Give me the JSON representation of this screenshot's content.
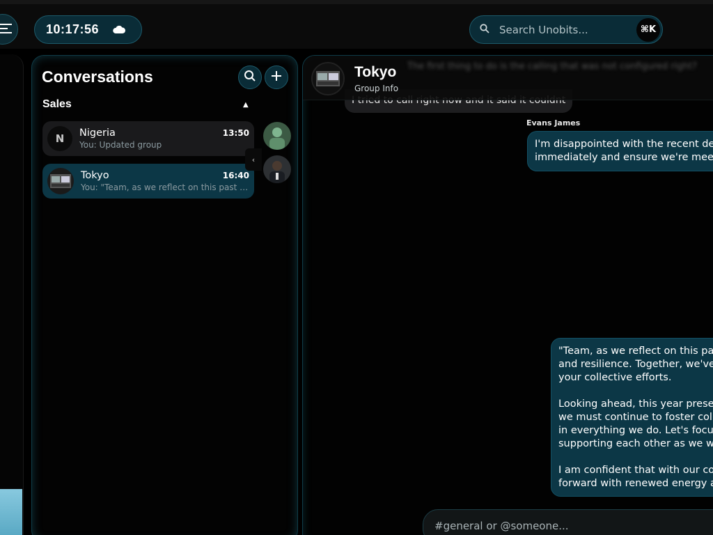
{
  "clock": {
    "time": "10:17:56",
    "weather_icon": "cloud-icon"
  },
  "search": {
    "placeholder": "Search Unobits...",
    "shortcut": "⌘K"
  },
  "conversations": {
    "title": "Conversations",
    "section": "Sales",
    "items": [
      {
        "initial": "N",
        "name": "Nigeria",
        "time": "13:50",
        "preview": "You: Updated group"
      },
      {
        "name": "Tokyo",
        "time": "16:40",
        "preview": "You: \"Team, as we reflect on this past yea..."
      }
    ]
  },
  "chat": {
    "title": "Tokyo",
    "subtitle": "Group Info",
    "blurred_banner": "The first thing to do is the calling that was not configured right?",
    "messages": [
      {
        "text": "I tried to call right now and it said it couldnt"
      },
      {
        "sender": "Evans James",
        "lines": [
          "I'm disappointed with the recent dela",
          "immediately and ensure we're meeting"
        ]
      },
      {
        "paragraphs": [
          [
            "\"Team, as we reflect on this past",
            "and resilience. Together, we've na",
            "your collective efforts."
          ],
          [
            "Looking ahead, this year present",
            "we must continue to foster colla",
            "in everything we do. Let's focus o",
            "supporting each other as we wo"
          ],
          [
            "I am confident that with our com",
            "forward with renewed energy an"
          ]
        ]
      }
    ],
    "composer_placeholder": "#general or @someone..."
  },
  "colors": {
    "accent": "#0c3746",
    "border": "#1d5a6a",
    "background": "#000000"
  }
}
